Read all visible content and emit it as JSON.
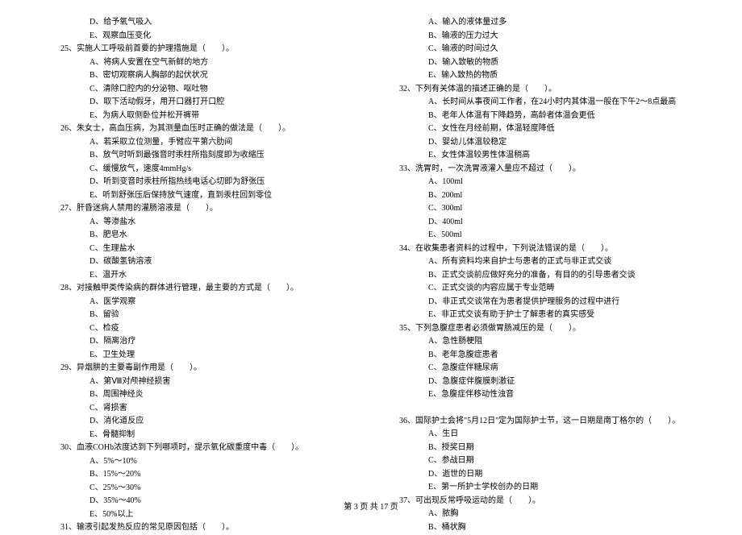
{
  "left": {
    "pre_options": [
      "D、给予氧气吸入",
      "E、观察血压变化"
    ],
    "questions": [
      {
        "num": "25、",
        "stem": "实施人工呼吸前首要的护理措施是（　　）。",
        "options": [
          "A、将病人安置在空气新鲜的地方",
          "B、密切观察病人胸部的起伏状况",
          "C、清除口腔内的分泌物、呕吐物",
          "D、取下活动假牙，用开口器打开口腔",
          "E、为病人取侧卧位并松开裤带"
        ]
      },
      {
        "num": "26、",
        "stem": "朱女士，高血压病，为其测量血压时正确的做法是（　　）。",
        "options": [
          "A、若采取立位测量，手臂应平第六肋间",
          "B、放气时听到最强音时汞柱所指刻度即为收缩压",
          "C、缓慢放气，速度4mmHg/s",
          "D、听到变音时汞柱所指热线电话心切即为舒张压",
          "E、听到舒张压后保持放气速度，直到汞柱回到零位"
        ]
      },
      {
        "num": "27、",
        "stem": "肝昏迷病人禁用的灌肠溶液是（　　）。",
        "options": [
          "A、等渗盐水",
          "B、肥皂水",
          "C、生理盐水",
          "D、碳酸氢钠溶液",
          "E、温开水"
        ]
      },
      {
        "num": "28、",
        "stem": "对接触甲类传染病的群体进行管理，最主要的方式是（　　）。",
        "options": [
          "A、医学观察",
          "B、留验",
          "C、检疫",
          "D、隔离治疗",
          "E、卫生处理"
        ]
      },
      {
        "num": "29、",
        "stem": "异烟肼的主要毒副作用是（　　）。",
        "options": [
          "A、第Ⅷ对颅神经损害",
          "B、周围神经炎",
          "C、肾损害",
          "D、消化道反应",
          "E、骨髓抑制"
        ]
      },
      {
        "num": "30、",
        "stem": "血液COHb浓度达到下列哪项时，提示氧化碳重度中毒（　　）。",
        "options": [
          "A、5%～10%",
          "B、15%～20%",
          "C、25%～30%",
          "D、35%～40%",
          "E、50%以上"
        ]
      },
      {
        "num": "31、",
        "stem": "输液引起发热反应的常见原因包括（　　）。",
        "options": []
      }
    ]
  },
  "right": {
    "pre_options": [
      "A、输入的液体量过多",
      "B、输液的压力过大",
      "C、输液的时间过久",
      "D、输入致敏的物质",
      "E、输入致热的物质"
    ],
    "questions": [
      {
        "num": "32、",
        "stem": "下列有关体温的描述正确的是（　　）。",
        "options": [
          "A、长时间从事夜间工作者，在24小时内其体温一般在下午2～8点最高",
          "B、老年人体温有下降趋势，高龄者体温会更低",
          "C、女性在月经前期，体温轻度降低",
          "D、婴幼儿体温较稳定",
          "E、女性体温较男性体温稍高"
        ]
      },
      {
        "num": "33、",
        "stem": "洗胃时，一次洗胃液灌入量应不超过（　　）。",
        "options": [
          "A、100ml",
          "B、200ml",
          "C、300ml",
          "D、400ml",
          "E、500ml"
        ]
      },
      {
        "num": "34、",
        "stem": "在收集患者资料的过程中，下列说法错误的是（　　）。",
        "options": [
          "A、所有资料均来自护士与患者的正式与非正式交谈",
          "B、正式交谈前应做好充分的准备，有目的的引导患者交谈",
          "C、正式交谈的内容应属于专业范畴",
          "D、非正式交谈常在为患者提供护理服务的过程中进行",
          "E、非正式交谈有助于护士了解患者的真实感受"
        ]
      },
      {
        "num": "35、",
        "stem": "下列急腹症患者必须做胃肠减压的是（　　）。",
        "options": [
          "A、急性肠梗阻",
          "B、老年急腹症患者",
          "C、急腹症伴糖尿病",
          "D、急腹症伴腹膜刺激征",
          "E、急腹症伴移动性浊音"
        ]
      },
      {
        "num": "36、",
        "stem": "国际护士会将\"5月12日\"定为国际护士节，这一日期是南丁格尔的（　　）。",
        "options": [
          "A、生日",
          "B、授奖日期",
          "C、参战日期",
          "D、逝世的日期",
          "E、第一所护士学校创办的日期"
        ]
      },
      {
        "num": "37、",
        "stem": "可出现反常呼吸运动的是（　　）。",
        "options": [
          "A、脓胸",
          "B、桶状胸"
        ]
      }
    ]
  },
  "footer": "第 3 页 共 17 页"
}
